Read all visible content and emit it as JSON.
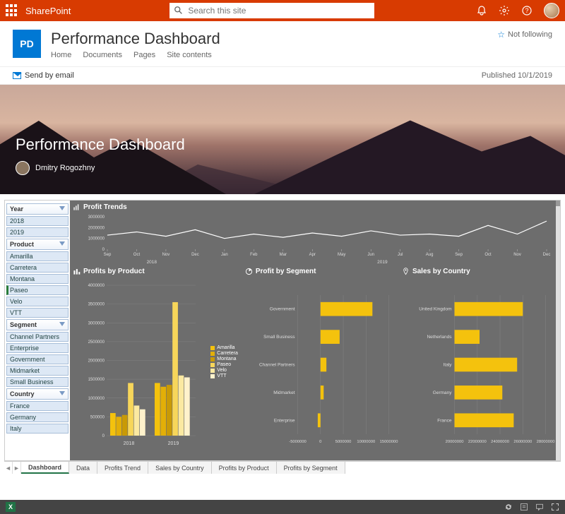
{
  "suite": {
    "app_name": "SharePoint",
    "search_placeholder": "Search this site"
  },
  "site": {
    "logo_initials": "PD",
    "title": "Performance Dashboard",
    "nav": [
      "Home",
      "Documents",
      "Pages",
      "Site contents"
    ],
    "follow_label": "Not following"
  },
  "commands": {
    "send_email": "Send by email",
    "publish_status": "Published 10/1/2019"
  },
  "hero": {
    "title": "Performance Dashboard",
    "author": "Dmitry Rogozhny"
  },
  "slicers": {
    "year": {
      "label": "Year",
      "items": [
        "2018",
        "2019"
      ]
    },
    "product": {
      "label": "Product",
      "items": [
        "Amarilla",
        "Carretera",
        "Montana",
        "Paseo",
        "Velo",
        "VTT"
      ],
      "selected": "Paseo"
    },
    "segment": {
      "label": "Segment",
      "items": [
        "Channel Partners",
        "Enterprise",
        "Government",
        "Midmarket",
        "Small Business"
      ]
    },
    "country": {
      "label": "Country",
      "items": [
        "France",
        "Germany",
        "Italy"
      ]
    }
  },
  "chart_titles": {
    "trends": "Profit Trends",
    "by_product": "Profits by Product",
    "by_segment": "Profit by Segment",
    "by_country": "Sales by Country"
  },
  "sheet_tabs": [
    "Dashboard",
    "Data",
    "Profits Trend",
    "Sales by Country",
    "Profits by Product",
    "Profits by Segment"
  ],
  "chart_data": [
    {
      "id": "profit_trends",
      "type": "line",
      "title": "Profit Trends",
      "x_categories": [
        "Sep",
        "Oct",
        "Nov",
        "Dec",
        "Jan",
        "Feb",
        "Mar",
        "Apr",
        "May",
        "Jun",
        "Jul",
        "Aug",
        "Sep",
        "Oct",
        "Nov",
        "Dec"
      ],
      "x_group_labels": {
        "2018": [
          "Sep",
          "Oct",
          "Nov",
          "Dec"
        ],
        "2019": [
          "Jan",
          "Feb",
          "Mar",
          "Apr",
          "May",
          "Jun",
          "Jul",
          "Aug",
          "Sep",
          "Oct",
          "Nov",
          "Dec"
        ]
      },
      "ylabel": "",
      "ylim": [
        0,
        3000000
      ],
      "y_ticks": [
        0,
        1000000,
        2000000,
        3000000
      ],
      "series": [
        {
          "name": "Profit",
          "values": [
            1300000,
            1600000,
            1200000,
            1800000,
            1000000,
            1400000,
            1100000,
            1500000,
            1200000,
            1700000,
            1300000,
            1400000,
            1200000,
            2200000,
            1400000,
            2600000
          ]
        }
      ]
    },
    {
      "id": "profits_by_product",
      "type": "bar",
      "title": "Profits by Product",
      "orientation": "vertical-grouped",
      "categories": [
        "2018",
        "2019"
      ],
      "ylim": [
        0,
        4000000
      ],
      "y_ticks": [
        0,
        500000,
        1000000,
        1500000,
        2000000,
        2500000,
        3000000,
        3500000,
        4000000
      ],
      "series": [
        {
          "name": "Amarilla",
          "color": "#f4c20d",
          "values": [
            600000,
            1400000
          ]
        },
        {
          "name": "Carretera",
          "color": "#e3af07",
          "values": [
            500000,
            1300000
          ]
        },
        {
          "name": "Montana",
          "color": "#c99a06",
          "values": [
            550000,
            1350000
          ]
        },
        {
          "name": "Paseo",
          "color": "#f7d65a",
          "values": [
            1400000,
            3550000
          ]
        },
        {
          "name": "Velo",
          "color": "#fbe9a1",
          "values": [
            800000,
            1600000
          ]
        },
        {
          "name": "VTT",
          "color": "#fff2cc",
          "values": [
            700000,
            1550000
          ]
        }
      ]
    },
    {
      "id": "profit_by_segment",
      "type": "bar",
      "title": "Profit by Segment",
      "orientation": "horizontal",
      "categories": [
        "Government",
        "Small Business",
        "Channel Partners",
        "Midmarket",
        "Enterprise"
      ],
      "xlim": [
        -5000000,
        15000000
      ],
      "x_ticks": [
        -5000000,
        0,
        5000000,
        10000000,
        15000000
      ],
      "values": [
        11400000,
        4200000,
        1300000,
        700000,
        -600000
      ],
      "color": "#f4c20d"
    },
    {
      "id": "sales_by_country",
      "type": "bar",
      "title": "Sales by Country",
      "orientation": "horizontal",
      "categories": [
        "United Kingdom",
        "Netherlands",
        "Italy",
        "Germany",
        "France"
      ],
      "xlim": [
        20000000,
        28000000
      ],
      "x_ticks": [
        20000000,
        22000000,
        24000000,
        26000000,
        28000000
      ],
      "values": [
        26000000,
        22200000,
        25500000,
        24200000,
        25200000
      ],
      "color": "#f4c20d"
    }
  ]
}
